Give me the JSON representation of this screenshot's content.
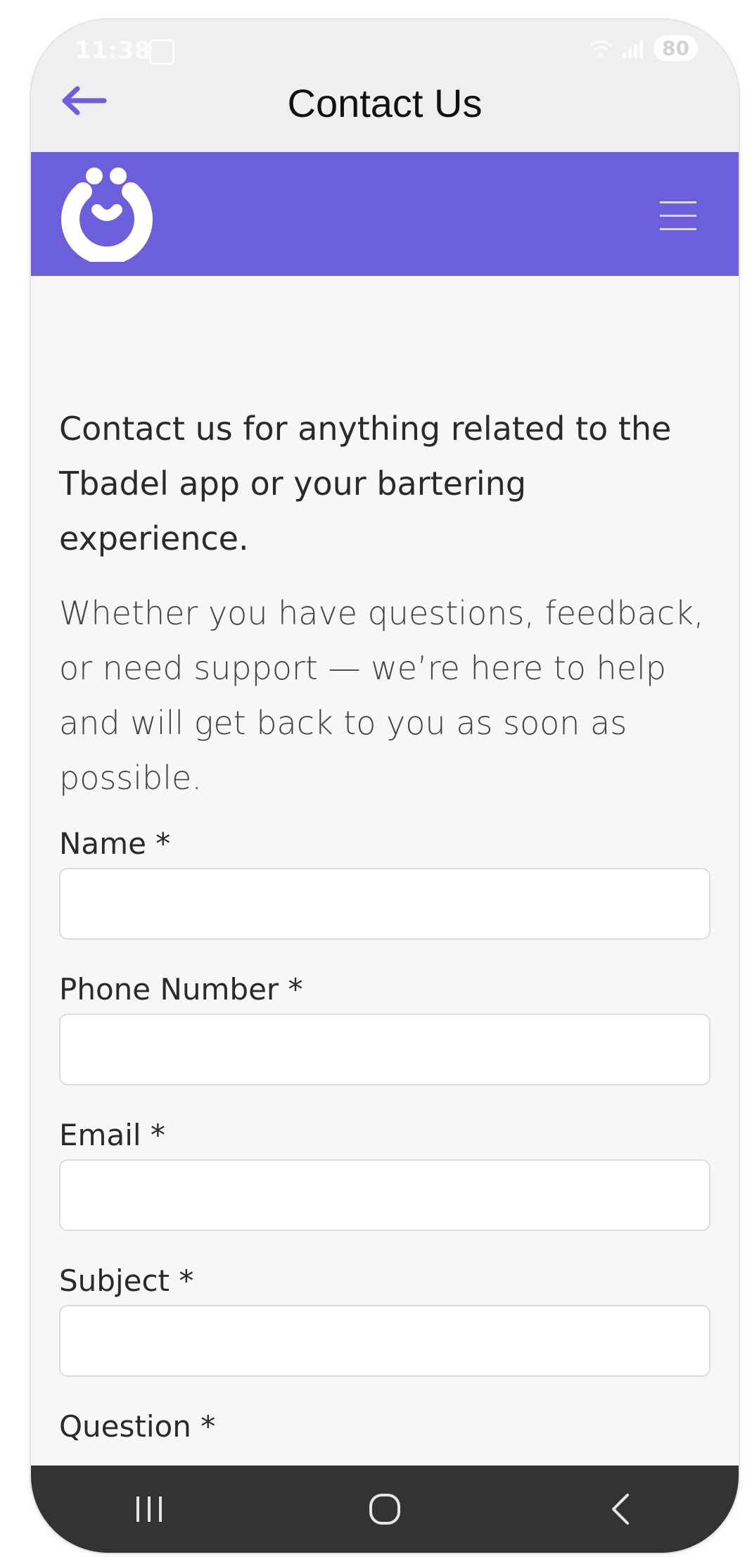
{
  "status_bar": {
    "time": "11:38",
    "battery": "80"
  },
  "app_bar": {
    "title": "Contact Us"
  },
  "colors": {
    "brand": "#6b5fdc",
    "back_arrow": "#6b5fdc",
    "nav_bar": "#333333"
  },
  "intro": {
    "heading": "Contact us for anything related to the Tbadel app or your bartering experience.",
    "body": "Whether you have questions, feedback, or need support — we’re here to help and will get back to you as soon as possible."
  },
  "form": {
    "name_label": "Name *",
    "name_value": "",
    "phone_label": "Phone Number *",
    "phone_value": "",
    "email_label": "Email *",
    "email_value": "",
    "subject_label": "Subject *",
    "subject_value": "",
    "question_label": "Question *"
  },
  "icons": {
    "back": "arrow-left-icon",
    "menu": "hamburger-menu-icon",
    "logo": "tbadel-logo",
    "nav_recent": "recent-apps-icon",
    "nav_home": "home-icon",
    "nav_back": "back-chevron-icon"
  }
}
